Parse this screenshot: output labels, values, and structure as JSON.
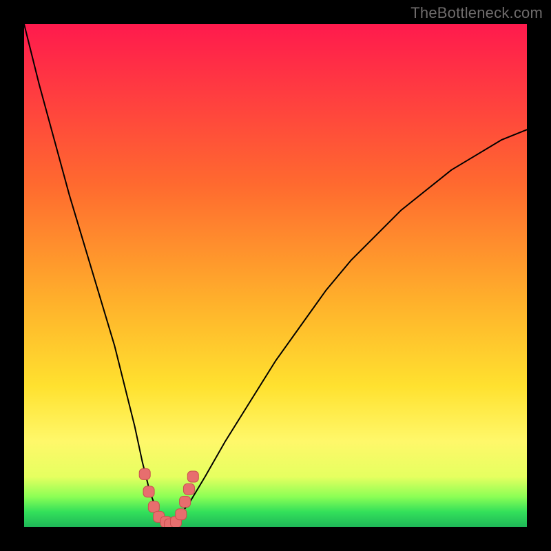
{
  "watermark": "TheBottleneck.com",
  "chart_data": {
    "type": "line",
    "title": "",
    "xlabel": "",
    "ylabel": "",
    "xlim": [
      0,
      100
    ],
    "ylim": [
      0,
      100
    ],
    "grid": false,
    "legend": false,
    "gradient_stops": [
      {
        "offset": 0.0,
        "color": "#ff1a4d"
      },
      {
        "offset": 0.32,
        "color": "#ff6a2f"
      },
      {
        "offset": 0.55,
        "color": "#ffb02b"
      },
      {
        "offset": 0.72,
        "color": "#ffe12f"
      },
      {
        "offset": 0.83,
        "color": "#fff86a"
      },
      {
        "offset": 0.9,
        "color": "#e6ff60"
      },
      {
        "offset": 0.94,
        "color": "#8cff55"
      },
      {
        "offset": 0.97,
        "color": "#33e05a"
      },
      {
        "offset": 1.0,
        "color": "#1fb858"
      }
    ],
    "series": [
      {
        "name": "bottleneck-curve",
        "x": [
          0,
          3,
          6,
          9,
          12,
          15,
          18,
          20,
          22,
          23.5,
          25,
          26.5,
          28,
          29,
          30,
          33,
          36,
          40,
          45,
          50,
          55,
          60,
          65,
          70,
          75,
          80,
          85,
          90,
          95,
          100
        ],
        "values": [
          100,
          88,
          77,
          66,
          56,
          46,
          36,
          28,
          20,
          13,
          7,
          3,
          1,
          0,
          1,
          5,
          10,
          17,
          25,
          33,
          40,
          47,
          53,
          58,
          63,
          67,
          71,
          74,
          77,
          79
        ]
      }
    ],
    "markers": [
      {
        "x": 24.0,
        "y": 10.5
      },
      {
        "x": 24.8,
        "y": 7.0
      },
      {
        "x": 25.8,
        "y": 4.0
      },
      {
        "x": 26.8,
        "y": 2.0
      },
      {
        "x": 28.2,
        "y": 1.0
      },
      {
        "x": 29.0,
        "y": 0.5
      },
      {
        "x": 30.2,
        "y": 1.0
      },
      {
        "x": 31.2,
        "y": 2.5
      },
      {
        "x": 32.0,
        "y": 5.0
      },
      {
        "x": 32.8,
        "y": 7.5
      },
      {
        "x": 33.6,
        "y": 10.0
      }
    ],
    "marker_style": {
      "shape": "rounded-square",
      "size": 16,
      "fill": "#e76e6e",
      "stroke": "#c94f4f"
    }
  }
}
